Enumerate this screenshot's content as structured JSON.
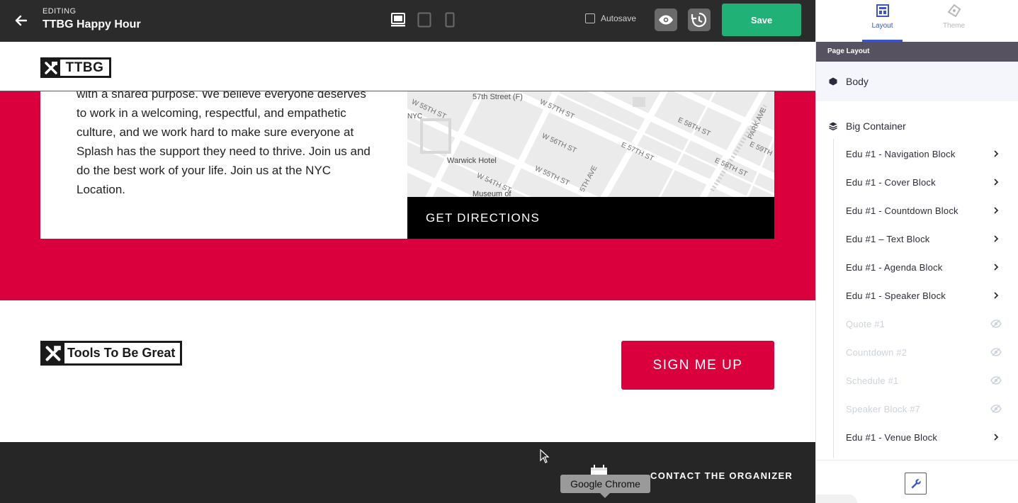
{
  "editor": {
    "editing_label": "EDITING",
    "title": "TTBG Happy Hour",
    "autosave_label": "Autosave",
    "save_label": "Save",
    "icons": [
      "back-arrow-icon",
      "desktop-icon",
      "tablet-icon",
      "mobile-icon",
      "preview-eye-icon",
      "history-icon"
    ]
  },
  "page": {
    "logo_text": "TTBG",
    "venue_text": "with a shared purpose. We believe everyone deserves to work in a welcoming, respectful, and empathetic culture, and we work hard to make sure everyone at Splash has the support they need to thrive. Join us and do the best work of your life. Join us at the NYC Location.",
    "map_labels": [
      "57th Street (F)",
      "W 55TH ST",
      "W 57TH ST",
      "NYC",
      "W 56TH ST",
      "E 57TH ST",
      "E 58TH ST",
      "PARK AVE",
      "E 59TH",
      "Warwick Hotel",
      "W 55TH ST",
      "W 54TH ST",
      "5TH AVE",
      "E 58TH ST",
      "Museum of"
    ],
    "directions_label": "GET DIRECTIONS",
    "footer_logo_text": "Tools To Be Great",
    "signup_label": "SIGN ME UP",
    "contact_label": "CONTACT THE ORGANIZER",
    "tooltip": "Google Chrome",
    "colors": {
      "accent_red": "#d9003d",
      "save_green": "#1fb176",
      "panel_blue": "#3d55c7"
    }
  },
  "panel": {
    "tabs": [
      {
        "label": "Layout",
        "icon": "layout-icon"
      },
      {
        "label": "Theme",
        "icon": "theme-icon"
      }
    ],
    "header": "Page Layout",
    "body_label": "Body",
    "container_label": "Big Container",
    "blocks": [
      {
        "label": "Edu #1 - Navigation Block",
        "hidden": false
      },
      {
        "label": "Edu #1 - Cover Block",
        "hidden": false
      },
      {
        "label": "Edu #1 - Countdown Block",
        "hidden": false
      },
      {
        "label": "Edu #1 – Text Block",
        "hidden": false
      },
      {
        "label": "Edu #1 - Agenda Block",
        "hidden": false
      },
      {
        "label": "Edu #1 - Speaker Block",
        "hidden": false
      },
      {
        "label": "Quote #1",
        "hidden": true
      },
      {
        "label": "Countdown #2",
        "hidden": true
      },
      {
        "label": "Schedule #1",
        "hidden": true
      },
      {
        "label": "Speaker Block #7",
        "hidden": true
      },
      {
        "label": "Edu #1 - Venue Block",
        "hidden": false
      }
    ]
  }
}
